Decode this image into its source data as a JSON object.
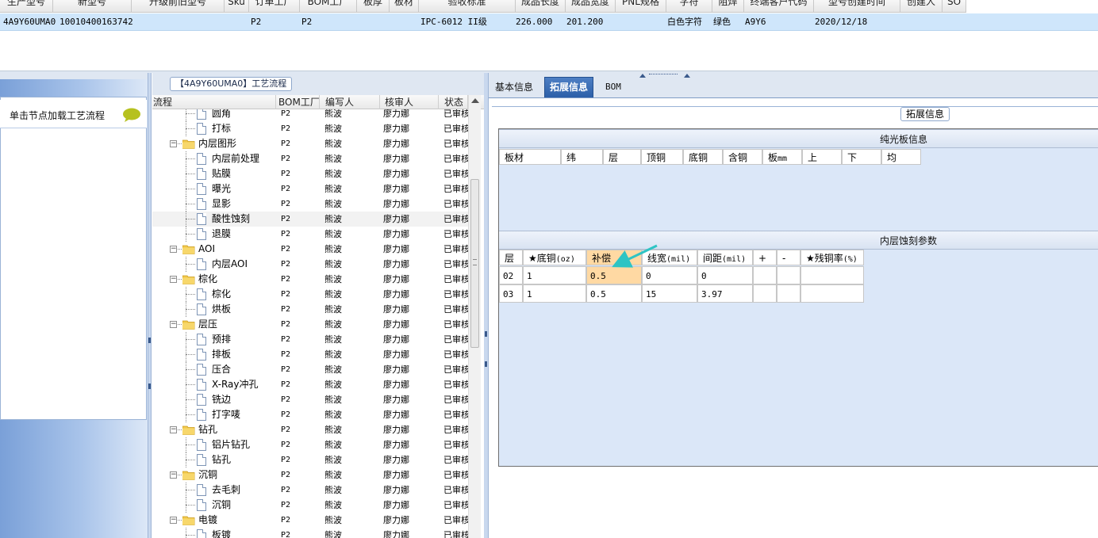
{
  "top_grid": {
    "headers": [
      "生产型号",
      "新型号",
      "升级前旧型号",
      "Sku",
      "订单工厂",
      "BOM工厂",
      "板厚",
      "板材",
      "验收标准",
      "成品长度",
      "成品宽度",
      "PNL规格",
      "字符",
      "阻焊",
      "终端客户代码",
      "型号创建时间",
      "创建人",
      "SO"
    ],
    "row": {
      "c1": "4A9Y60UMA0",
      "c2": "10010400163742",
      "c3": "",
      "c4": "",
      "c5": "P2",
      "c6": "P2",
      "c7": "",
      "c8": "",
      "c9": "IPC-6012 II级",
      "c10": "226.000",
      "c11": "201.200",
      "c12": "",
      "c13": "白色字符",
      "c14": "绿色",
      "c15": "A9Y6",
      "c16": "2020/12/18",
      "c17": "",
      "c18": ""
    }
  },
  "left_panel": {
    "hint": "单击节点加载工艺流程",
    "bubble_icon": "speech-bubble-icon"
  },
  "tree": {
    "title": "【4A9Y60UMA0】工艺流程",
    "headers": {
      "flow": "流程",
      "bom": "BOM工厂",
      "writer": "编写人",
      "reviewer": "核审人",
      "status": "状态"
    },
    "rows": [
      {
        "name": "圆角",
        "type": "doc",
        "bom": "P2",
        "writer": "熊波",
        "reviewer": "廖力娜",
        "status": "已审核"
      },
      {
        "name": "打标",
        "type": "doc",
        "bom": "P2",
        "writer": "熊波",
        "reviewer": "廖力娜",
        "status": "已审核"
      },
      {
        "name": "内层图形",
        "type": "folder",
        "bom": "P2",
        "writer": "熊波",
        "reviewer": "廖力娜",
        "status": "已审核"
      },
      {
        "name": "内层前处理",
        "type": "doc",
        "bom": "P2",
        "writer": "熊波",
        "reviewer": "廖力娜",
        "status": "已审核"
      },
      {
        "name": "贴膜",
        "type": "doc",
        "bom": "P2",
        "writer": "熊波",
        "reviewer": "廖力娜",
        "status": "已审核"
      },
      {
        "name": "曝光",
        "type": "doc",
        "bom": "P2",
        "writer": "熊波",
        "reviewer": "廖力娜",
        "status": "已审核"
      },
      {
        "name": "显影",
        "type": "doc",
        "bom": "P2",
        "writer": "熊波",
        "reviewer": "廖力娜",
        "status": "已审核"
      },
      {
        "name": "酸性蚀刻",
        "type": "doc",
        "bom": "P2",
        "writer": "熊波",
        "reviewer": "廖力娜",
        "status": "已审核",
        "selected": true
      },
      {
        "name": "退膜",
        "type": "doc",
        "bom": "P2",
        "writer": "熊波",
        "reviewer": "廖力娜",
        "status": "已审核"
      },
      {
        "name": "AOI",
        "type": "folder",
        "bom": "P2",
        "writer": "熊波",
        "reviewer": "廖力娜",
        "status": "已审核"
      },
      {
        "name": "内层AOI",
        "type": "doc",
        "bom": "P2",
        "writer": "熊波",
        "reviewer": "廖力娜",
        "status": "已审核"
      },
      {
        "name": "棕化",
        "type": "folder",
        "bom": "P2",
        "writer": "熊波",
        "reviewer": "廖力娜",
        "status": "已审核"
      },
      {
        "name": "棕化",
        "type": "doc",
        "bom": "P2",
        "writer": "熊波",
        "reviewer": "廖力娜",
        "status": "已审核"
      },
      {
        "name": "烘板",
        "type": "doc",
        "bom": "P2",
        "writer": "熊波",
        "reviewer": "廖力娜",
        "status": "已审核"
      },
      {
        "name": "层压",
        "type": "folder",
        "bom": "P2",
        "writer": "熊波",
        "reviewer": "廖力娜",
        "status": "已审核"
      },
      {
        "name": "预排",
        "type": "doc",
        "bom": "P2",
        "writer": "熊波",
        "reviewer": "廖力娜",
        "status": "已审核"
      },
      {
        "name": "排板",
        "type": "doc",
        "bom": "P2",
        "writer": "熊波",
        "reviewer": "廖力娜",
        "status": "已审核"
      },
      {
        "name": "压合",
        "type": "doc",
        "bom": "P2",
        "writer": "熊波",
        "reviewer": "廖力娜",
        "status": "已审核"
      },
      {
        "name": "X-Ray冲孔",
        "type": "doc",
        "bom": "P2",
        "writer": "熊波",
        "reviewer": "廖力娜",
        "status": "已审核"
      },
      {
        "name": "铣边",
        "type": "doc",
        "bom": "P2",
        "writer": "熊波",
        "reviewer": "廖力娜",
        "status": "已审核"
      },
      {
        "name": "打字唛",
        "type": "doc",
        "bom": "P2",
        "writer": "熊波",
        "reviewer": "廖力娜",
        "status": "已审核"
      },
      {
        "name": "钻孔",
        "type": "folder",
        "bom": "P2",
        "writer": "熊波",
        "reviewer": "廖力娜",
        "status": "已审核"
      },
      {
        "name": "铝片钻孔",
        "type": "doc",
        "bom": "P2",
        "writer": "熊波",
        "reviewer": "廖力娜",
        "status": "已审核"
      },
      {
        "name": "钻孔",
        "type": "doc",
        "bom": "P2",
        "writer": "熊波",
        "reviewer": "廖力娜",
        "status": "已审核"
      },
      {
        "name": "沉铜",
        "type": "folder",
        "bom": "P2",
        "writer": "熊波",
        "reviewer": "廖力娜",
        "status": "已审核"
      },
      {
        "name": "去毛刺",
        "type": "doc",
        "bom": "P2",
        "writer": "熊波",
        "reviewer": "廖力娜",
        "status": "已审核"
      },
      {
        "name": "沉铜",
        "type": "doc",
        "bom": "P2",
        "writer": "熊波",
        "reviewer": "廖力娜",
        "status": "已审核"
      },
      {
        "name": "电镀",
        "type": "folder",
        "bom": "P2",
        "writer": "熊波",
        "reviewer": "廖力娜",
        "status": "已审核"
      },
      {
        "name": "板镀",
        "type": "doc",
        "bom": "P2",
        "writer": "熊波",
        "reviewer": "廖力娜",
        "status": "已审核"
      }
    ]
  },
  "tabs": {
    "items": [
      "基本信息",
      "拓展信息",
      "BOM"
    ],
    "active": "拓展信息"
  },
  "extension": {
    "group_label": "拓展信息",
    "section1_title": "纯光板信息",
    "section1_headers": [
      {
        "main": "板材",
        "unit": ""
      },
      {
        "main": "纬",
        "unit": ""
      },
      {
        "main": "层",
        "unit": ""
      },
      {
        "main": "顶铜",
        "unit": ""
      },
      {
        "main": "底铜",
        "unit": ""
      },
      {
        "main": "含铜",
        "unit": ""
      },
      {
        "main": "板",
        "unit": "mm"
      },
      {
        "main": "上",
        "unit": ""
      },
      {
        "main": "下",
        "unit": ""
      },
      {
        "main": "均",
        "unit": ""
      }
    ],
    "section2_title": "内层蚀刻参数",
    "section2_headers": [
      {
        "main": "层",
        "unit": ""
      },
      {
        "main": "★底铜",
        "unit": "(oz)"
      },
      {
        "main": "补偿",
        "unit": ""
      },
      {
        "main": "线宽",
        "unit": "(mil)"
      },
      {
        "main": "间距",
        "unit": "(mil)"
      },
      {
        "main": "+",
        "unit": ""
      },
      {
        "main": "-",
        "unit": ""
      },
      {
        "main": "★残铜率",
        "unit": "(%)"
      }
    ],
    "section2_rows": [
      [
        "02",
        "1",
        "0.5",
        "0",
        "0",
        "",
        "",
        ""
      ],
      [
        "03",
        "1",
        "0.5",
        "15",
        "3.97",
        "",
        "",
        ""
      ]
    ]
  },
  "annotation": {
    "arrow_color": "#2ec4c4",
    "highlight_color": "#ffd9a3"
  }
}
